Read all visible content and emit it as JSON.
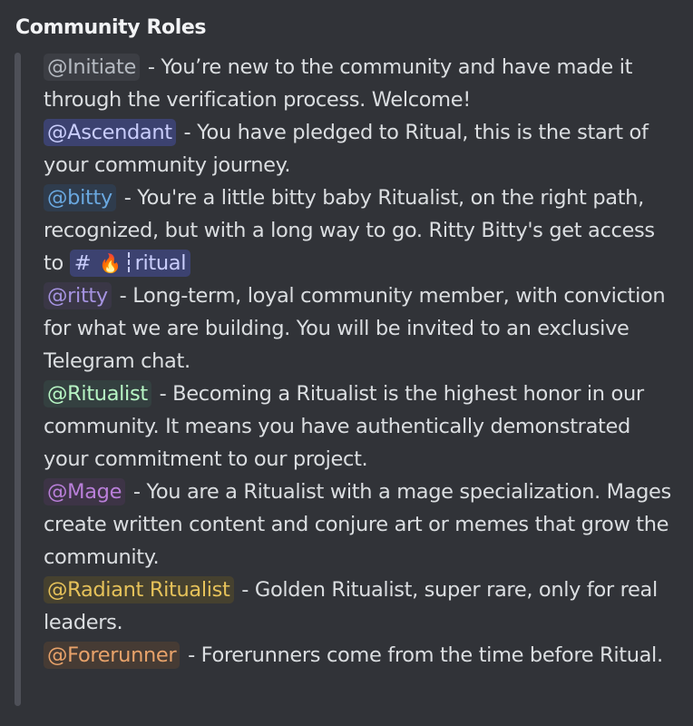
{
  "header": {
    "title": "Community Roles"
  },
  "colors": {
    "background": "#313338",
    "quote_bar": "#4e5058",
    "text": "#dbdee1"
  },
  "roles": [
    {
      "mention": "@Initiate",
      "text": " - You’re new to the community and have made it through the verification process. Welcome!",
      "color": "#b5bac1",
      "bg": "#3c3e44"
    },
    {
      "mention": "@Ascendant",
      "text": " - You have pledged to Ritual, this is the start of your community journey.",
      "color": "#c9cdfb",
      "bg": "#3c4270"
    },
    {
      "mention": "@bitty",
      "text": " - You're a little bitty baby Ritualist, on the right path, recognized, but with a long way to go. Ritty Bitty's get access to ",
      "color": "#6aa8e0",
      "bg": "#2f3c4d"
    },
    {
      "mention": "@ritty",
      "text": " - Long-term, loyal community member, with conviction for what we are building. You will be invited to an exclusive Telegram chat.",
      "color": "#a593e0",
      "bg": "#3a3746"
    },
    {
      "mention": "@Ritualist",
      "text": " - Becoming a Ritualist is the highest honor in our community. It means you have authentically demonstrated your commitment to our project.",
      "color": "#b7f5c4",
      "bg": "#344040"
    },
    {
      "mention": "@Mage",
      "text": " - You are a Ritualist with a mage specialization. Mages create written content and conjure art or memes that grow the community.",
      "color": "#b97fd9",
      "bg": "#3d3446"
    },
    {
      "mention": "@Radiant Ritualist",
      "text": " - Golden Ritualist, super rare, only for real leaders.",
      "color": "#e6c25a",
      "bg": "#46412f"
    },
    {
      "mention": "@Forerunner",
      "text": " - Forerunners come from the time before Ritual.",
      "color": "#e8a26a",
      "bg": "#463b34"
    }
  ],
  "channel_link": {
    "hash": "#",
    "icon": "🔥",
    "icon_name": "fire-icon",
    "name": "ritual"
  }
}
